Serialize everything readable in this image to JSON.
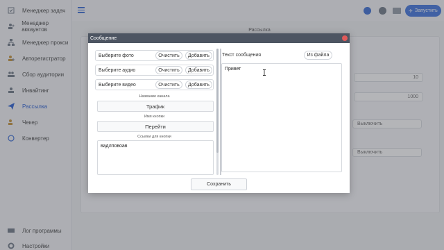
{
  "sidebar": {
    "items": [
      {
        "label": "Менеджер задач",
        "icon": "tasks-icon"
      },
      {
        "label": "Менеджер аккаунтов",
        "icon": "accounts-icon"
      },
      {
        "label": "Менеджер прокси",
        "icon": "proxy-icon"
      },
      {
        "label": "Авторегистратор",
        "icon": "autoreg-icon"
      },
      {
        "label": "Сбор аудитории",
        "icon": "audience-icon"
      },
      {
        "label": "Инвайтинг",
        "icon": "invite-icon"
      },
      {
        "label": "Рассылка",
        "icon": "mailing-icon",
        "active": true
      },
      {
        "label": "Чекер",
        "icon": "checker-icon"
      },
      {
        "label": "Конвертер",
        "icon": "converter-icon"
      }
    ],
    "bottom": [
      {
        "label": "Лог программы",
        "icon": "log-icon"
      },
      {
        "label": "Настройки",
        "icon": "settings-icon"
      }
    ]
  },
  "topbar": {
    "run_label": "Запустить"
  },
  "background": {
    "section_title": "Рассылка",
    "field_1": "10",
    "field_2": "1000",
    "toggle_1": "Выключить",
    "toggle_2": "Выключить"
  },
  "modal": {
    "title": "Сообщение",
    "photo_label": "Выберите фото",
    "audio_label": "Выберите аудио",
    "video_label": "Выберите видео",
    "clear_label": "Очистить",
    "add_label": "Добавить",
    "channel_name_caption": "Название канала",
    "channel_name_value": "Трафик",
    "button_name_caption": "Имя кнопки",
    "button_name_value": "Перейти",
    "links_caption": "Ссылки для кнопки",
    "links_value": "вадлповоав",
    "message_label": "Текст сообщения",
    "from_file_label": "Из файла",
    "message_value": "Привет",
    "save_label": "Сохранить"
  },
  "colors": {
    "accent": "#4f7fe0",
    "modal_header": "#4d5562",
    "close": "#e05a5a"
  }
}
